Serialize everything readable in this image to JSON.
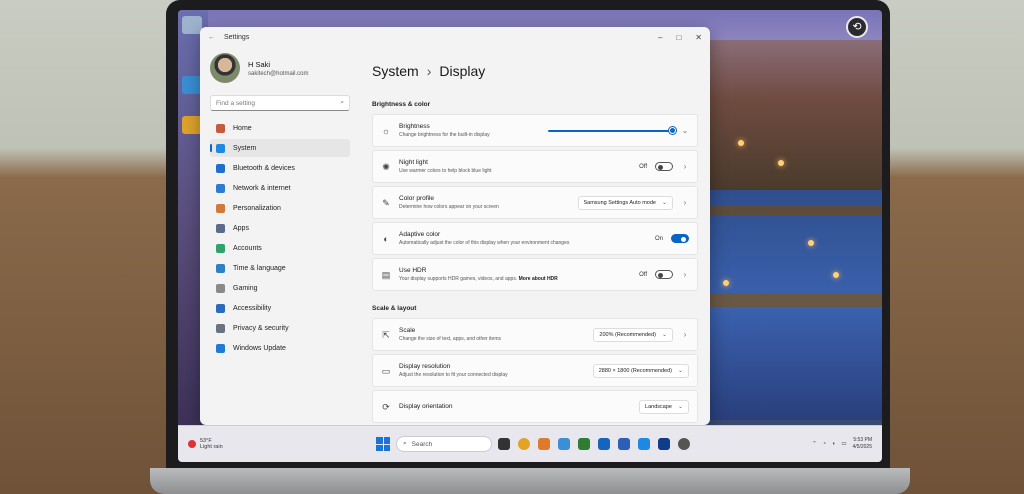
{
  "window": {
    "app_title": "Settings",
    "back": "←",
    "minimize": "–",
    "maximize": "□",
    "close": "✕"
  },
  "profile": {
    "name": "H Saki",
    "email": "sakitech@hotmail.com"
  },
  "search": {
    "placeholder": "Find a setting"
  },
  "sidebar": {
    "items": [
      {
        "label": "Home",
        "color": "#c55a3d"
      },
      {
        "label": "System",
        "color": "#1e88e5"
      },
      {
        "label": "Bluetooth & devices",
        "color": "#1e6fd0"
      },
      {
        "label": "Network & internet",
        "color": "#2e7bd6"
      },
      {
        "label": "Personalization",
        "color": "#d27a3c"
      },
      {
        "label": "Apps",
        "color": "#5b6b8c"
      },
      {
        "label": "Accounts",
        "color": "#2fa36b"
      },
      {
        "label": "Time & language",
        "color": "#2f7fc4"
      },
      {
        "label": "Gaming",
        "color": "#8a8a8a"
      },
      {
        "label": "Accessibility",
        "color": "#2a6bbf"
      },
      {
        "label": "Privacy & security",
        "color": "#6b7280"
      },
      {
        "label": "Windows Update",
        "color": "#1f7ad8"
      }
    ]
  },
  "header": {
    "parent": "System",
    "separator": "›",
    "title": "Display"
  },
  "sections": {
    "brightness_color": "Brightness & color",
    "scale_layout": "Scale & layout"
  },
  "brightness": {
    "title": "Brightness",
    "subtitle": "Change brightness for the built-in display",
    "level_percent": 100
  },
  "night_light": {
    "title": "Night light",
    "subtitle": "Use warmer colors to help block blue light",
    "state": "Off"
  },
  "color_profile": {
    "title": "Color profile",
    "subtitle": "Determine how colors appear on your screen",
    "value": "Samsung Settings Auto mode"
  },
  "adaptive_color": {
    "title": "Adaptive color",
    "subtitle": "Automatically adjust the color of this display when your environment changes",
    "state": "On"
  },
  "hdr": {
    "title": "Use HDR",
    "subtitle": "Your display supports HDR games, videos, and apps.",
    "link": "More about HDR",
    "state": "Off"
  },
  "scale": {
    "title": "Scale",
    "subtitle": "Change the size of text, apps, and other items",
    "value": "200% (Recommended)"
  },
  "resolution": {
    "title": "Display resolution",
    "subtitle": "Adjust the resolution to fit your connected display",
    "value": "2880 × 1800 (Recommended)"
  },
  "orientation": {
    "title": "Display orientation",
    "value": "Landscape"
  },
  "taskbar": {
    "weather_temp": "53°F",
    "weather_desc": "Light rain",
    "search_label": "Search",
    "time": "5:53 PM",
    "date": "4/5/2025"
  },
  "icons": {
    "chevron": "›",
    "chevron_down": "⌄",
    "search": "⌕"
  }
}
